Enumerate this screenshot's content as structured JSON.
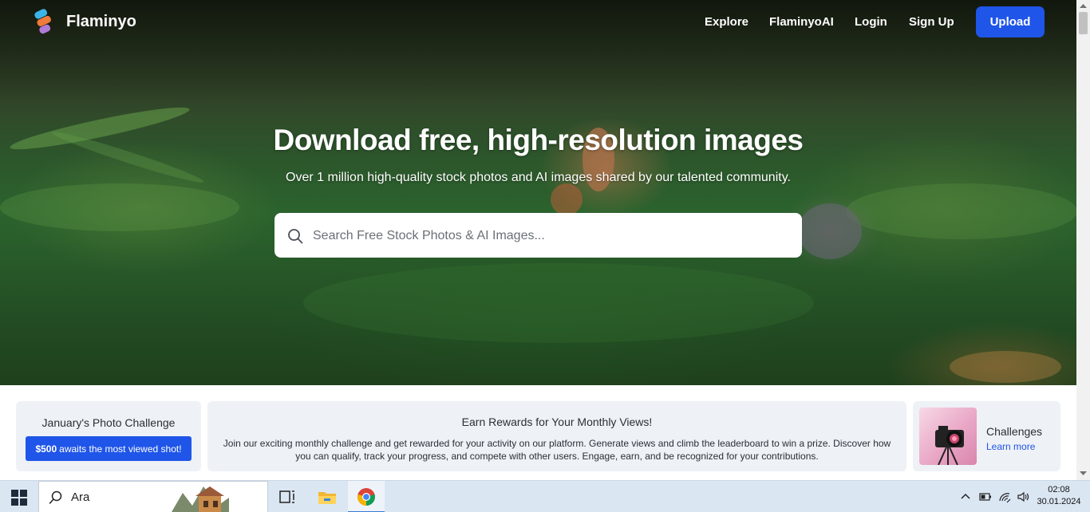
{
  "nav": {
    "brand": "Flaminyo",
    "links": [
      "Explore",
      "FlaminyoAI",
      "Login",
      "Sign Up"
    ],
    "upload_label": "Upload"
  },
  "hero": {
    "title": "Download free, high-resolution images",
    "subtitle": "Over 1 million high-quality stock photos and AI images shared by our talented community.",
    "search_placeholder": "Search Free Stock Photos & AI Images..."
  },
  "banners": {
    "challenge": {
      "title": "January's Photo Challenge",
      "button_bold": "$500",
      "button_rest": "awaits the most viewed shot!"
    },
    "rewards": {
      "title": "Earn Rewards for Your Monthly Views!",
      "body": "Join our exciting monthly challenge and get rewarded for your activity on our platform. Generate views and climb the leaderboard to win a prize. Discover how you can qualify, track your progress, and compete with other users. Engage, earn, and be recognized for your contributions."
    },
    "challenges": {
      "title": "Challenges",
      "link": "Learn more"
    }
  },
  "taskbar": {
    "search_text": "Ara",
    "time": "02:08",
    "date": "30.01.2024",
    "icons": [
      "windows-start-icon",
      "search-icon",
      "task-view-icon",
      "file-explorer-icon",
      "chrome-icon",
      "chevron-up-icon",
      "battery-icon",
      "wifi-icon",
      "volume-icon"
    ]
  },
  "colors": {
    "accent": "#1f55e8",
    "card_bg": "#eef1f6",
    "taskbar_bg": "#dbe6f3"
  }
}
